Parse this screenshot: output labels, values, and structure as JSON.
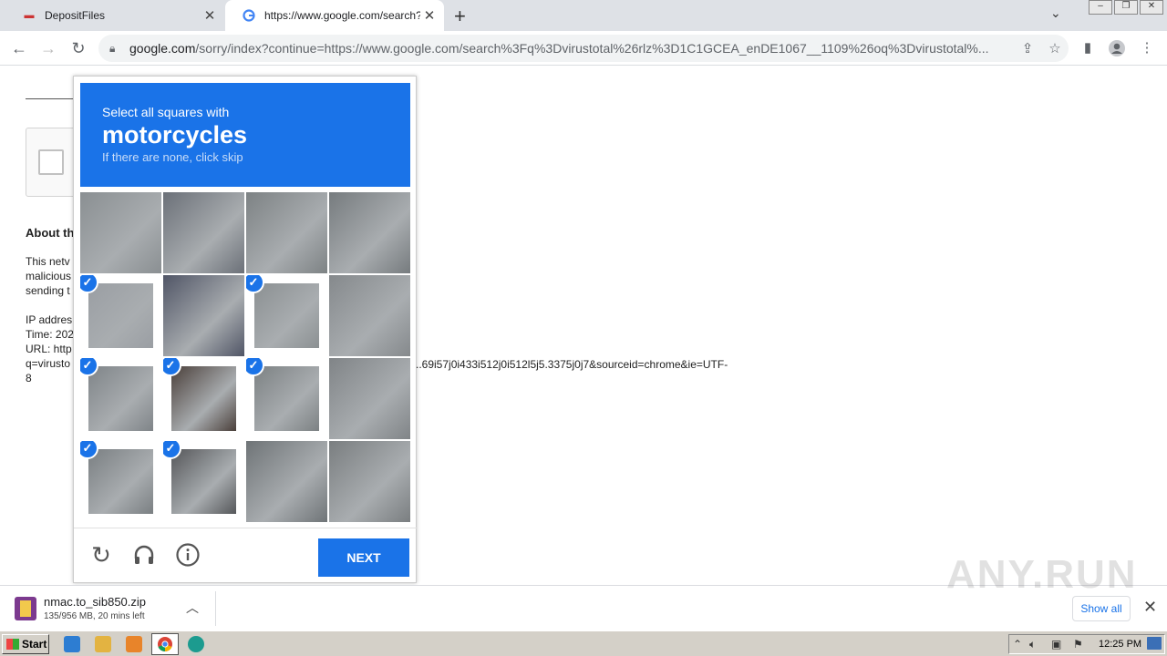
{
  "tabs": [
    {
      "title": "DepositFiles",
      "close": "✕"
    },
    {
      "title": "https://www.google.com/search?q=",
      "close": "✕"
    }
  ],
  "new_tab": "+",
  "address_bar": {
    "host": "google.com",
    "path": "/sorry/index?continue=https://www.google.com/search%3Fq%3Dvirustotal%26rlz%3D1C1GCEA_enDE1067__1109%26oq%3Dvirustotal%..."
  },
  "page": {
    "about_heading": "About th",
    "para_lines": [
      "This netv",
      "malicious",
      "sending t"
    ],
    "ip_line": "IP addres",
    "time_line": "Time: 202",
    "url_line": "URL: http",
    "q_line": "q=virusto",
    "q_tail": "..69i57j0i433i512j0i512l5j5.3375j0j7&sourceid=chrome&ie=UTF-",
    "eight_line": "8"
  },
  "captcha": {
    "instruction": "Select all squares with",
    "target": "motorcycles",
    "hint": "If there are none, click skip",
    "check_glyph": "✓",
    "tiles": [
      {
        "selected": false,
        "color": "#8a8f92"
      },
      {
        "selected": false,
        "color": "#6b7078"
      },
      {
        "selected": false,
        "color": "#7d8284"
      },
      {
        "selected": false,
        "color": "#767b7e"
      },
      {
        "selected": true,
        "color": "#9a9ea3"
      },
      {
        "selected": false,
        "color": "#505566"
      },
      {
        "selected": true,
        "color": "#8b9092"
      },
      {
        "selected": false,
        "color": "#85898c"
      },
      {
        "selected": true,
        "color": "#7f8488"
      },
      {
        "selected": true,
        "color": "#4a3f3a"
      },
      {
        "selected": true,
        "color": "#7c8183"
      },
      {
        "selected": false,
        "color": "#808487"
      },
      {
        "selected": true,
        "color": "#7a7f82"
      },
      {
        "selected": true,
        "color": "#55575a"
      },
      {
        "selected": false,
        "color": "#6f7477"
      },
      {
        "selected": false,
        "color": "#7a7e80"
      }
    ],
    "next_label": "NEXT"
  },
  "download": {
    "filename": "nmac.to_sib850.zip",
    "status": "135/956 MB, 20 mins left",
    "show_all": "Show all"
  },
  "taskbar": {
    "start_label": "Start",
    "clock": "12:25 PM"
  },
  "watermark": "ANY.RUN",
  "colors": {
    "accent": "#1a73e8"
  }
}
